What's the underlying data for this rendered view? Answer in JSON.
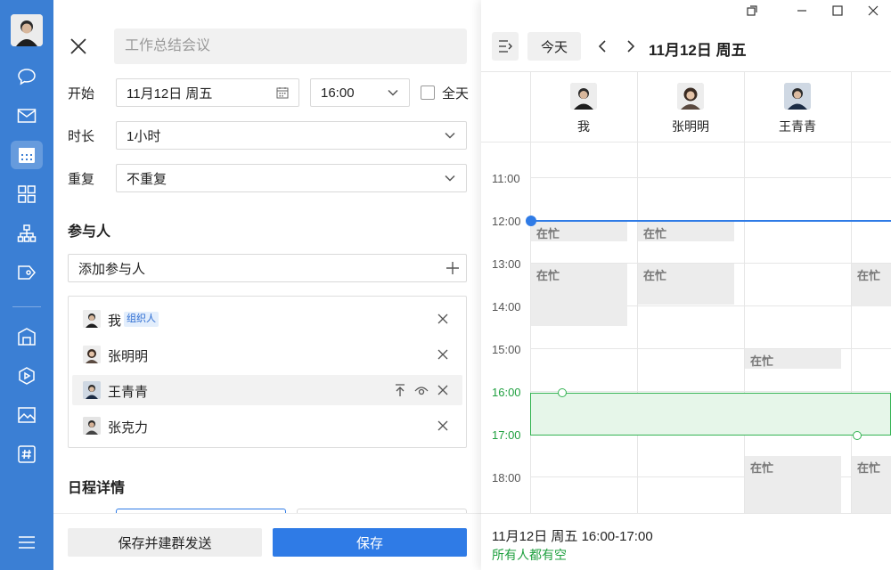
{
  "title_input": {
    "placeholder": "工作总结会议"
  },
  "form": {
    "start_label": "开始",
    "start_date": "11月12日 周五",
    "start_time": "16:00",
    "allday_label": "全天",
    "duration_label": "时长",
    "duration_value": "1小时",
    "repeat_label": "重复",
    "repeat_value": "不重复",
    "participants_title": "参与人",
    "add_participant": "添加参与人",
    "details_title": "日程详情"
  },
  "participants": [
    {
      "name": "我",
      "tag": "组织人"
    },
    {
      "name": "张明明"
    },
    {
      "name": "王青青"
    },
    {
      "name": "张克力"
    }
  ],
  "footer": {
    "save_group_label": "保存并建群发送",
    "save_label": "保存"
  },
  "calendar": {
    "toggle_icon": "panel-collapse-icon",
    "today_label": "今天",
    "date_title": "11月12日 周五",
    "columns": [
      {
        "name": "我"
      },
      {
        "name": "张明明"
      },
      {
        "name": "王青青"
      },
      {
        "name": "张"
      }
    ],
    "hours": [
      "11:00",
      "12:00",
      "13:00",
      "14:00",
      "15:00",
      "16:00",
      "17:00",
      "18:00"
    ],
    "busy_label": "在忙",
    "selection_summary": "11月12日 周五 16:00-17:00",
    "availability": "所有人都有空"
  },
  "colors": {
    "rail": "#3b7fd4",
    "primary": "#2f7be6",
    "free_green": "#20a040"
  }
}
